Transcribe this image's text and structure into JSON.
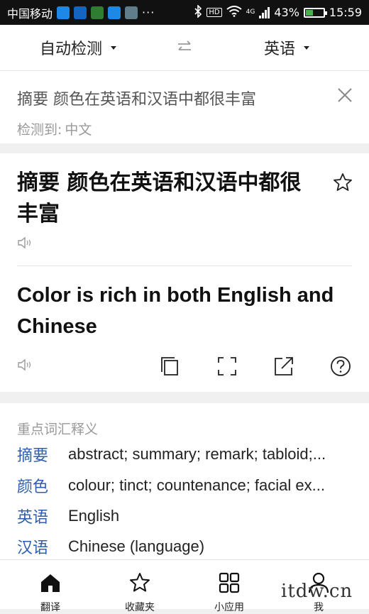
{
  "status_bar": {
    "carrier": "中国移动",
    "more": "···",
    "network_badge": "HD",
    "network_type": "4G",
    "battery_percent": "43%",
    "battery_level": 0.43,
    "time": "15:59",
    "app_icon_colors": [
      "#1e88e5",
      "#1565c0",
      "#2e7d32",
      "#1e88e5",
      "#607d8b"
    ]
  },
  "language_bar": {
    "source_lang": "自动检测",
    "target_lang": "英语",
    "swap_icon": "swap-arrows-icon"
  },
  "input": {
    "text": "摘要 颜色在英语和汉语中都很丰富",
    "detected_label": "检测到:",
    "detected_lang": "中文"
  },
  "result": {
    "source_text": "摘要 颜色在英语和汉语中都很丰富",
    "translation": "Color is rich in both English and Chinese"
  },
  "vocab": {
    "title": "重点词汇释义",
    "items": [
      {
        "word": "摘要",
        "definition": "abstract; summary; remark; tabloid;..."
      },
      {
        "word": "颜色",
        "definition": "colour; tinct; countenance; facial ex..."
      },
      {
        "word": "英语",
        "definition": "English"
      },
      {
        "word": "汉语",
        "definition": "Chinese (language)"
      }
    ]
  },
  "bottom_nav": {
    "items": [
      {
        "label": "翻译",
        "icon": "home-icon"
      },
      {
        "label": "收藏夹",
        "icon": "star-icon"
      },
      {
        "label": "小应用",
        "icon": "apps-grid-icon"
      },
      {
        "label": "我",
        "icon": "person-icon"
      }
    ]
  },
  "watermark": "itdw.cn",
  "colors": {
    "accent_blue": "#2f5eb0",
    "muted_text": "#999999",
    "background": "#f0f0f0"
  }
}
